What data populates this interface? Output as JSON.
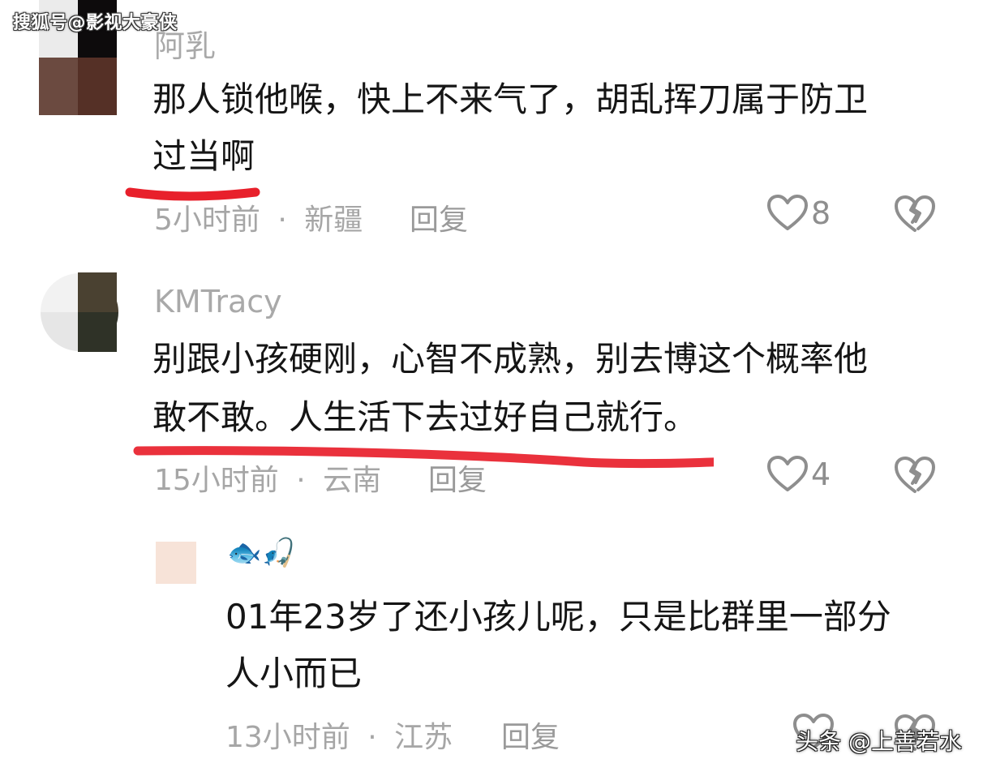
{
  "watermarks": {
    "top": "搜狐号@影视大豪侠",
    "bottom": "头条 @上善若水"
  },
  "comments": [
    {
      "username": "阿乳",
      "text_lines": [
        "那人锁他喉，快上不来气了，胡乱挥刀属于防卫",
        "过当啊"
      ],
      "time": "5小时前",
      "location": "新疆",
      "reply_label": "回复",
      "likes": "8",
      "avatar_colors": [
        "#ffffff",
        "#0d0b0c",
        "#6b4a40",
        "#553026"
      ]
    },
    {
      "username": "KMTracy",
      "text_lines": [
        "别跟小孩硬刚，心智不成熟，别去博这个概率他",
        "敢不敢。人生活下去过好自己就行。"
      ],
      "time": "15小时前",
      "location": "云南",
      "reply_label": "回复",
      "likes": "4",
      "avatar_colors": [
        "#f2f2f2",
        "#4a4131",
        "#e6e6e6",
        "#2f3227"
      ]
    },
    {
      "username": "🐟🎣",
      "text_lines": [
        "01年23岁了还小孩儿呢，只是比群里一部分",
        "人小而已"
      ],
      "time": "13小时前",
      "location": "江苏",
      "reply_label": "回复",
      "likes": "",
      "avatar_colors": [
        "#f7e3d8",
        "#ffffff",
        "#f7e3d8",
        "#ffffff"
      ]
    }
  ],
  "separator": "·",
  "icons": {
    "like": "heart-outline-icon",
    "dislike": "broken-heart-icon",
    "highlight_color": "#e8202b"
  }
}
